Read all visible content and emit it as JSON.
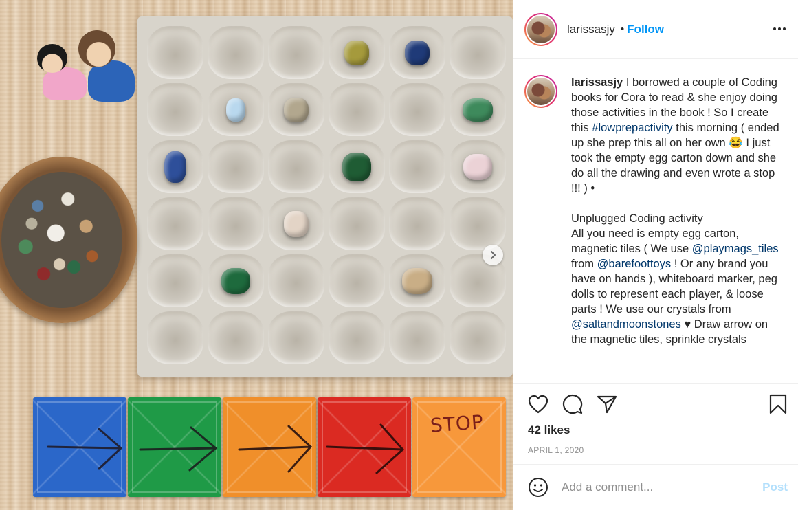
{
  "post": {
    "username": "larissasjy",
    "dot": "•",
    "follow_label": "Follow",
    "carousel_next_icon": "chevron-right-icon",
    "photo_stop_text": "STOP"
  },
  "caption": {
    "username": "larissasjy",
    "text_1": " I borrowed a couple of Coding books for Cora to read & she enjoy doing those activities in the book ! So I create this ",
    "tag_1": "#lowprepactivity",
    "text_2": " this morning ( ended up she prep this all on her own 😂 I just took the empty egg carton down and she do all the drawing and even wrote a stop !!! ) •\n\nUnplugged Coding activity\nAll you need is empty egg carton, magnetic tiles ( We use ",
    "tag_2": "@playmags_tiles",
    "text_3": " from ",
    "tag_3": "@barefoottoys",
    "text_4": " ! Or any brand you have on hands ), whiteboard marker, peg dolls to represent each player, & loose parts ! We use our crystals from ",
    "tag_4": "@saltandmoonstones",
    "text_5": " ♥ Draw arrow on the magnetic tiles, sprinkle crystals"
  },
  "actions": {
    "like_icon": "heart-icon",
    "comment_icon": "comment-bubble-icon",
    "share_icon": "paper-plane-icon",
    "save_icon": "bookmark-icon",
    "likes_text": "42 likes",
    "date_text": "APRIL 1, 2020"
  },
  "comment_box": {
    "emoji_icon": "smiley-icon",
    "placeholder": "Add a comment...",
    "post_label": "Post"
  },
  "colors": {
    "accent": "#0095f6",
    "post_disabled": "#b2dffc",
    "tag": "#00376b"
  }
}
